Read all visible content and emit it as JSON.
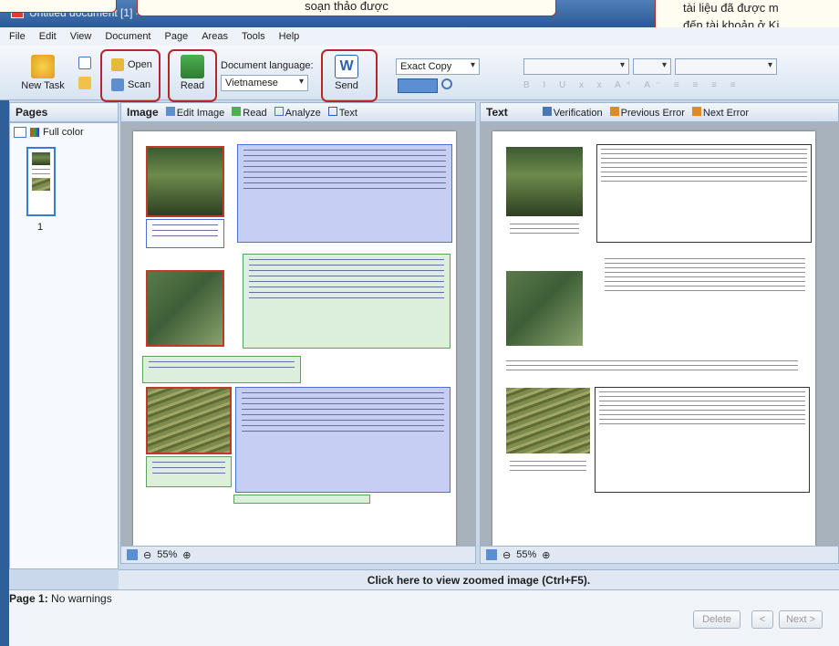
{
  "app": {
    "title": "Untitled document [1] - ABBYY FineReader 11 Professional Edition"
  },
  "callouts": {
    "center": "soạn thảo được",
    "right_line1": "tài liệu đã được m",
    "right_line2": "đến tài khoản ở Ki"
  },
  "menu": [
    "File",
    "Edit",
    "View",
    "Document",
    "Page",
    "Areas",
    "Tools",
    "Help"
  ],
  "toolbar": {
    "new_task": "New Task",
    "open": "Open",
    "scan": "Scan",
    "read": "Read",
    "document_language_label": "Document language:",
    "document_language_value": "Vietnamese",
    "send": "Send",
    "format_value": "Exact Copy",
    "font_size_hint": "A⁺ A⁻"
  },
  "pages_panel": {
    "title": "Pages",
    "mode": "Full color",
    "page_number": "1"
  },
  "image_panel": {
    "title": "Image",
    "tools": [
      "Edit Image",
      "Read",
      "Analyze",
      "Text"
    ],
    "zoom": "55%"
  },
  "text_panel": {
    "title": "Text",
    "tools": [
      "Verification",
      "Previous Error",
      "Next Error"
    ],
    "zoom": "55%"
  },
  "zoom_hint": "Click here to view zoomed image (Ctrl+F5).",
  "status": {
    "page_label": "Page 1:",
    "message": "No warnings"
  },
  "buttons": {
    "delete": "Delete",
    "prev": "<",
    "next": "Next >"
  },
  "colors": {
    "titlebar": "#2c5a96",
    "callout_border": "#b8262a",
    "text_zone": "#4a6fd6",
    "picture_zone": "#c0392b",
    "background_zone": "#5aa35a"
  }
}
